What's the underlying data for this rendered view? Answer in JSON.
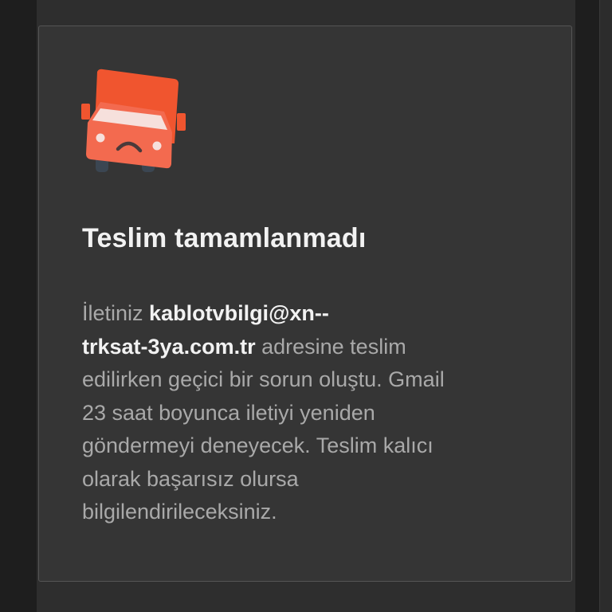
{
  "notification": {
    "icon": "sad-delivery-truck-icon",
    "accent_color": "#f4623a",
    "title": "Teslim tamamlanmadı",
    "message": {
      "prefix": "İletiniz ",
      "address_line1": "kablotvbilgi@xn--",
      "address_line2": "trksat-3ya.com.tr",
      "after_address": " adresine teslim",
      "line3": "edilirken geçici bir sorun oluştu. Gmail",
      "line4": "23 saat boyunca iletiyi yeniden",
      "line5": "göndermeyi deneyecek. Teslim kalıcı",
      "line6": "olarak başarısız olursa",
      "line7": "bilgilendirileceksiniz."
    }
  }
}
